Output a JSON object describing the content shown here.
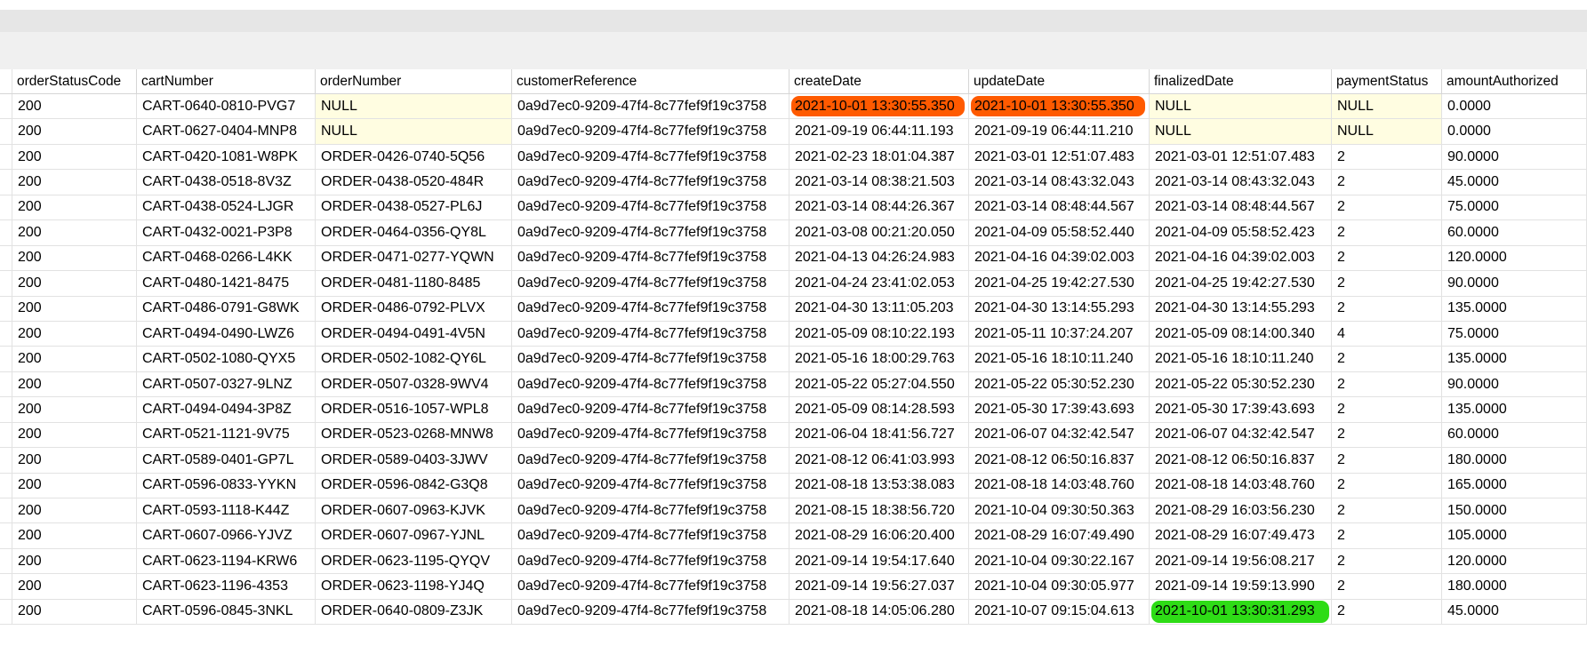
{
  "columns": [
    "orderStatusCode",
    "cartNumber",
    "orderNumber",
    "customerReference",
    "createDate",
    "updateDate",
    "finalizedDate",
    "paymentStatus",
    "amountAuthorized"
  ],
  "rows": [
    [
      "200",
      "CART-0640-0810-PVG7",
      "NULL",
      "0a9d7ec0-9209-47f4-8c77fef9f19c3758",
      "2021-10-01 13:30:55.350",
      "2021-10-01 13:30:55.350",
      "NULL",
      "NULL",
      "0.0000"
    ],
    [
      "200",
      "CART-0627-0404-MNP8",
      "NULL",
      "0a9d7ec0-9209-47f4-8c77fef9f19c3758",
      "2021-09-19 06:44:11.193",
      "2021-09-19 06:44:11.210",
      "NULL",
      "NULL",
      "0.0000"
    ],
    [
      "200",
      "CART-0420-1081-W8PK",
      "ORDER-0426-0740-5Q56",
      "0a9d7ec0-9209-47f4-8c77fef9f19c3758",
      "2021-02-23 18:01:04.387",
      "2021-03-01 12:51:07.483",
      "2021-03-01 12:51:07.483",
      "2",
      "90.0000"
    ],
    [
      "200",
      "CART-0438-0518-8V3Z",
      "ORDER-0438-0520-484R",
      "0a9d7ec0-9209-47f4-8c77fef9f19c3758",
      "2021-03-14 08:38:21.503",
      "2021-03-14 08:43:32.043",
      "2021-03-14 08:43:32.043",
      "2",
      "45.0000"
    ],
    [
      "200",
      "CART-0438-0524-LJGR",
      "ORDER-0438-0527-PL6J",
      "0a9d7ec0-9209-47f4-8c77fef9f19c3758",
      "2021-03-14 08:44:26.367",
      "2021-03-14 08:48:44.567",
      "2021-03-14 08:48:44.567",
      "2",
      "75.0000"
    ],
    [
      "200",
      "CART-0432-0021-P3P8",
      "ORDER-0464-0356-QY8L",
      "0a9d7ec0-9209-47f4-8c77fef9f19c3758",
      "2021-03-08 00:21:20.050",
      "2021-04-09 05:58:52.440",
      "2021-04-09 05:58:52.423",
      "2",
      "60.0000"
    ],
    [
      "200",
      "CART-0468-0266-L4KK",
      "ORDER-0471-0277-YQWN",
      "0a9d7ec0-9209-47f4-8c77fef9f19c3758",
      "2021-04-13 04:26:24.983",
      "2021-04-16 04:39:02.003",
      "2021-04-16 04:39:02.003",
      "2",
      "120.0000"
    ],
    [
      "200",
      "CART-0480-1421-8475",
      "ORDER-0481-1180-8485",
      "0a9d7ec0-9209-47f4-8c77fef9f19c3758",
      "2021-04-24 23:41:02.053",
      "2021-04-25 19:42:27.530",
      "2021-04-25 19:42:27.530",
      "2",
      "90.0000"
    ],
    [
      "200",
      "CART-0486-0791-G8WK",
      "ORDER-0486-0792-PLVX",
      "0a9d7ec0-9209-47f4-8c77fef9f19c3758",
      "2021-04-30 13:11:05.203",
      "2021-04-30 13:14:55.293",
      "2021-04-30 13:14:55.293",
      "2",
      "135.0000"
    ],
    [
      "200",
      "CART-0494-0490-LWZ6",
      "ORDER-0494-0491-4V5N",
      "0a9d7ec0-9209-47f4-8c77fef9f19c3758",
      "2021-05-09 08:10:22.193",
      "2021-05-11 10:37:24.207",
      "2021-05-09 08:14:00.340",
      "4",
      "75.0000"
    ],
    [
      "200",
      "CART-0502-1080-QYX5",
      "ORDER-0502-1082-QY6L",
      "0a9d7ec0-9209-47f4-8c77fef9f19c3758",
      "2021-05-16 18:00:29.763",
      "2021-05-16 18:10:11.240",
      "2021-05-16 18:10:11.240",
      "2",
      "135.0000"
    ],
    [
      "200",
      "CART-0507-0327-9LNZ",
      "ORDER-0507-0328-9WV4",
      "0a9d7ec0-9209-47f4-8c77fef9f19c3758",
      "2021-05-22 05:27:04.550",
      "2021-05-22 05:30:52.230",
      "2021-05-22 05:30:52.230",
      "2",
      "90.0000"
    ],
    [
      "200",
      "CART-0494-0494-3P8Z",
      "ORDER-0516-1057-WPL8",
      "0a9d7ec0-9209-47f4-8c77fef9f19c3758",
      "2021-05-09 08:14:28.593",
      "2021-05-30 17:39:43.693",
      "2021-05-30 17:39:43.693",
      "2",
      "135.0000"
    ],
    [
      "200",
      "CART-0521-1121-9V75",
      "ORDER-0523-0268-MNW8",
      "0a9d7ec0-9209-47f4-8c77fef9f19c3758",
      "2021-06-04 18:41:56.727",
      "2021-06-07 04:32:42.547",
      "2021-06-07 04:32:42.547",
      "2",
      "60.0000"
    ],
    [
      "200",
      "CART-0589-0401-GP7L",
      "ORDER-0589-0403-3JWV",
      "0a9d7ec0-9209-47f4-8c77fef9f19c3758",
      "2021-08-12 06:41:03.993",
      "2021-08-12 06:50:16.837",
      "2021-08-12 06:50:16.837",
      "2",
      "180.0000"
    ],
    [
      "200",
      "CART-0596-0833-YYKN",
      "ORDER-0596-0842-G3Q8",
      "0a9d7ec0-9209-47f4-8c77fef9f19c3758",
      "2021-08-18 13:53:38.083",
      "2021-08-18 14:03:48.760",
      "2021-08-18 14:03:48.760",
      "2",
      "165.0000"
    ],
    [
      "200",
      "CART-0593-1118-K44Z",
      "ORDER-0607-0963-KJVK",
      "0a9d7ec0-9209-47f4-8c77fef9f19c3758",
      "2021-08-15 18:38:56.720",
      "2021-10-04 09:30:50.363",
      "2021-08-29 16:03:56.230",
      "2",
      "150.0000"
    ],
    [
      "200",
      "CART-0607-0966-YJVZ",
      "ORDER-0607-0967-YJNL",
      "0a9d7ec0-9209-47f4-8c77fef9f19c3758",
      "2021-08-29 16:06:20.400",
      "2021-08-29 16:07:49.490",
      "2021-08-29 16:07:49.473",
      "2",
      "105.0000"
    ],
    [
      "200",
      "CART-0623-1194-KRW6",
      "ORDER-0623-1195-QYQV",
      "0a9d7ec0-9209-47f4-8c77fef9f19c3758",
      "2021-09-14 19:54:17.640",
      "2021-10-04 09:30:22.167",
      "2021-09-14 19:56:08.217",
      "2",
      "120.0000"
    ],
    [
      "200",
      "CART-0623-1196-4353",
      "ORDER-0623-1198-YJ4Q",
      "0a9d7ec0-9209-47f4-8c77fef9f19c3758",
      "2021-09-14 19:56:27.037",
      "2021-10-04 09:30:05.977",
      "2021-09-14 19:59:13.990",
      "2",
      "180.0000"
    ],
    [
      "200",
      "CART-0596-0845-3NKL",
      "ORDER-0640-0809-Z3JK",
      "0a9d7ec0-9209-47f4-8c77fef9f19c3758",
      "2021-08-18 14:05:06.280",
      "2021-10-07 09:15:04.613",
      "2021-10-01 13:30:31.293",
      "2",
      "45.0000"
    ]
  ],
  "highlights": {
    "orange_color": "#ff5a00",
    "green_color": "#2edc16",
    "null_cell_color": "#fffde1"
  }
}
